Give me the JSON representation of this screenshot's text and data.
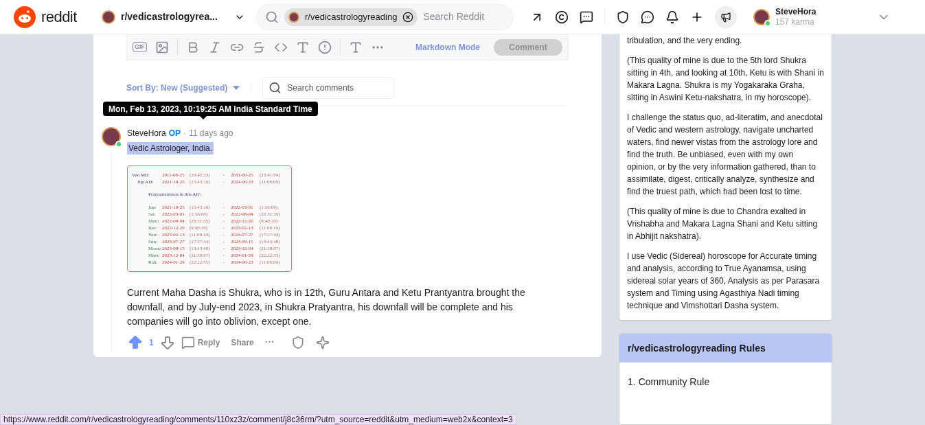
{
  "header": {
    "logo_text": "reddit",
    "community": "r/vedicastrologyrea...",
    "search_chip": "r/vedicastrologyreading",
    "search_placeholder": "Search Reddit",
    "user": {
      "name": "SteveHora",
      "karma": "157 karma",
      "online": true
    }
  },
  "editor": {
    "gif_label": "GIF",
    "markdown_mode": "Markdown Mode",
    "comment_button": "Comment",
    "comment_disabled": true
  },
  "sort": {
    "label": "Sort By: New (Suggested)",
    "search_placeholder": "Search comments"
  },
  "tooltip": "Mon, Feb 13, 2023, 10:19:25 AM India Standard Time",
  "comment": {
    "author": "SteveHora",
    "op_badge": "OP",
    "separator": "·",
    "time": "11 days ago",
    "flair": "Vedic Astrologer, India.",
    "online": true,
    "image_table": {
      "periods": [
        {
          "label": "Ven MD:",
          "indent": false,
          "start": "2011-08-25",
          "start_time": "(20:42:23)",
          "dash": "-",
          "end": "2031-08-25",
          "end_time": "(23:41:04)"
        },
        {
          "label": "Jup AD:",
          "indent": true,
          "start": "2021-10-25",
          "start_time": "(15:45:16)",
          "dash": "-",
          "end": "2024-06-23",
          "end_time": "(11:08:09)"
        }
      ],
      "subtitle": "Pratyantardasas in this AD:",
      "rows": [
        {
          "label": "Jup:",
          "start": "2021-10-25",
          "start_time": "(15:45:16)",
          "dash": "-",
          "end": "2022-03-01",
          "end_time": "(1:56:08)"
        },
        {
          "label": "Sat:",
          "start": "2022-03-01",
          "start_time": "(1:56:08)",
          "dash": "-",
          "end": "2022-08-04",
          "end_time": "(20:31:35)"
        },
        {
          "label": "Merc:",
          "start": "2022-08-04",
          "start_time": "(20:31:35)",
          "dash": "-",
          "end": "2022-12-20",
          "end_time": "(9:40:29)"
        },
        {
          "label": "Ket:",
          "start": "2022-12-20",
          "start_time": "(9:40:29)",
          "dash": "-",
          "end": "2023-02-13",
          "end_time": "(11:08:19)"
        },
        {
          "label": "Ven:",
          "start": "2023-02-13",
          "start_time": "(11:08:19)",
          "dash": "-",
          "end": "2023-07-27",
          "end_time": "(17:57:34)"
        },
        {
          "label": "Sun:",
          "start": "2023-07-27",
          "start_time": "(17:57:34)",
          "dash": "-",
          "end": "2023-09-15",
          "end_time": "(13:43:48)"
        },
        {
          "label": "Moon:",
          "start": "2023-09-15",
          "start_time": "(13:43:48)",
          "dash": "-",
          "end": "2023-12-04",
          "end_time": "(21:58:07)"
        },
        {
          "label": "Mars:",
          "start": "2023-12-04",
          "start_time": "(21:58:07)",
          "dash": "-",
          "end": "2024-01-28",
          "end_time": "(22:22:55)"
        },
        {
          "label": "Rah:",
          "start": "2024-01-28",
          "start_time": "(22:22:55)",
          "dash": "-",
          "end": "2024-06-23",
          "end_time": "(11:08:09)"
        }
      ]
    },
    "body": "Current Maha Dasha is Shukra, who is in 12th, Guru Antara and Ketu Prantyantra brought the downfall, and by July-end 2023, in Shukra Pratyantra, his downfall will be complete and his companies will go into oblivion, except one.",
    "score": "1",
    "upvoted": true,
    "reply": "Reply",
    "share": "Share",
    "more": "···"
  },
  "sidebar": {
    "paragraphs": [
      "tribulation, and the very ending.",
      "(This quality of mine is due to the 5th lord Shukra sitting in 4th, and looking at 10th, Ketu is with Shani in Makara Lagna. Shukra is my Yogakaraka Graha, sitting in Aswini Ketu-nakshatra, in my horoscope).",
      "I challenge the status quo, ad-literatim, and anecdotal of Vedic and western astrology, navigate uncharted waters, find newer vistas from the astrology lore and find the truth. Be unbiased, even with my own opinion, or by the very information gathered, than to assimilate, digest, critically analyze, synthesize and find the truest path, which had been lost to time.",
      "(This quality of mine is due to Chandra exalted in Vrishabha and Makara Lagna Shani and Ketu sitting in Abhijit nakshatra).",
      "I use Vedic (Sidereal) horoscope for Accurate timing and analysis, according to True Ayanamsa, using sidereal solar years of 360, Analysis as per Parasara system and Timing using Agasthiya Nadi timing technique and Vimshottari Dasha system."
    ]
  },
  "rules": {
    "title": "r/vedicastrologyreading Rules",
    "items": [
      {
        "number": "1.",
        "text": "Community Rule"
      }
    ]
  },
  "status_url": "https://www.reddit.com/r/vedicastrologyreading/comments/110xz3z/comment/j8c36rm/?utm_source=reddit&utm_medium=web2x&context=3"
}
